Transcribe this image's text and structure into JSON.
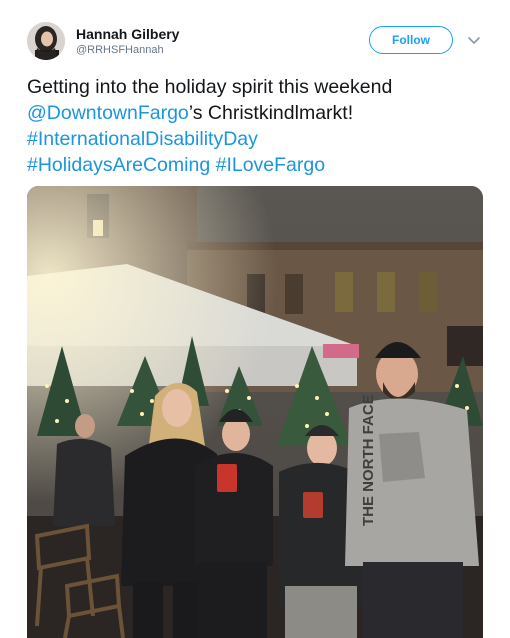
{
  "author": {
    "name": "Hannah Gilbery",
    "handle": "@RRHSFHannah",
    "avatar_icon": "profile-photo"
  },
  "follow_button": {
    "label": "Follow"
  },
  "menu_icon": "chevron-down-icon",
  "tweet": {
    "line1": "Getting into the holiday spirit this weekend",
    "mention": "@DowntownFargo",
    "mention_suffix": "’s Christkindlmarkt!",
    "hashtag1": "#InternationalDisabilityDay",
    "hashtag2": "#HolidaysAreComing",
    "hashtag3": "#ILoveFargo"
  },
  "media": {
    "description_icon": "photo",
    "shirt_text": "THE NORTH FACE"
  },
  "colors": {
    "accent": "#1da1f2",
    "link": "#1b95e0",
    "text": "#14171a",
    "muted": "#657786"
  }
}
